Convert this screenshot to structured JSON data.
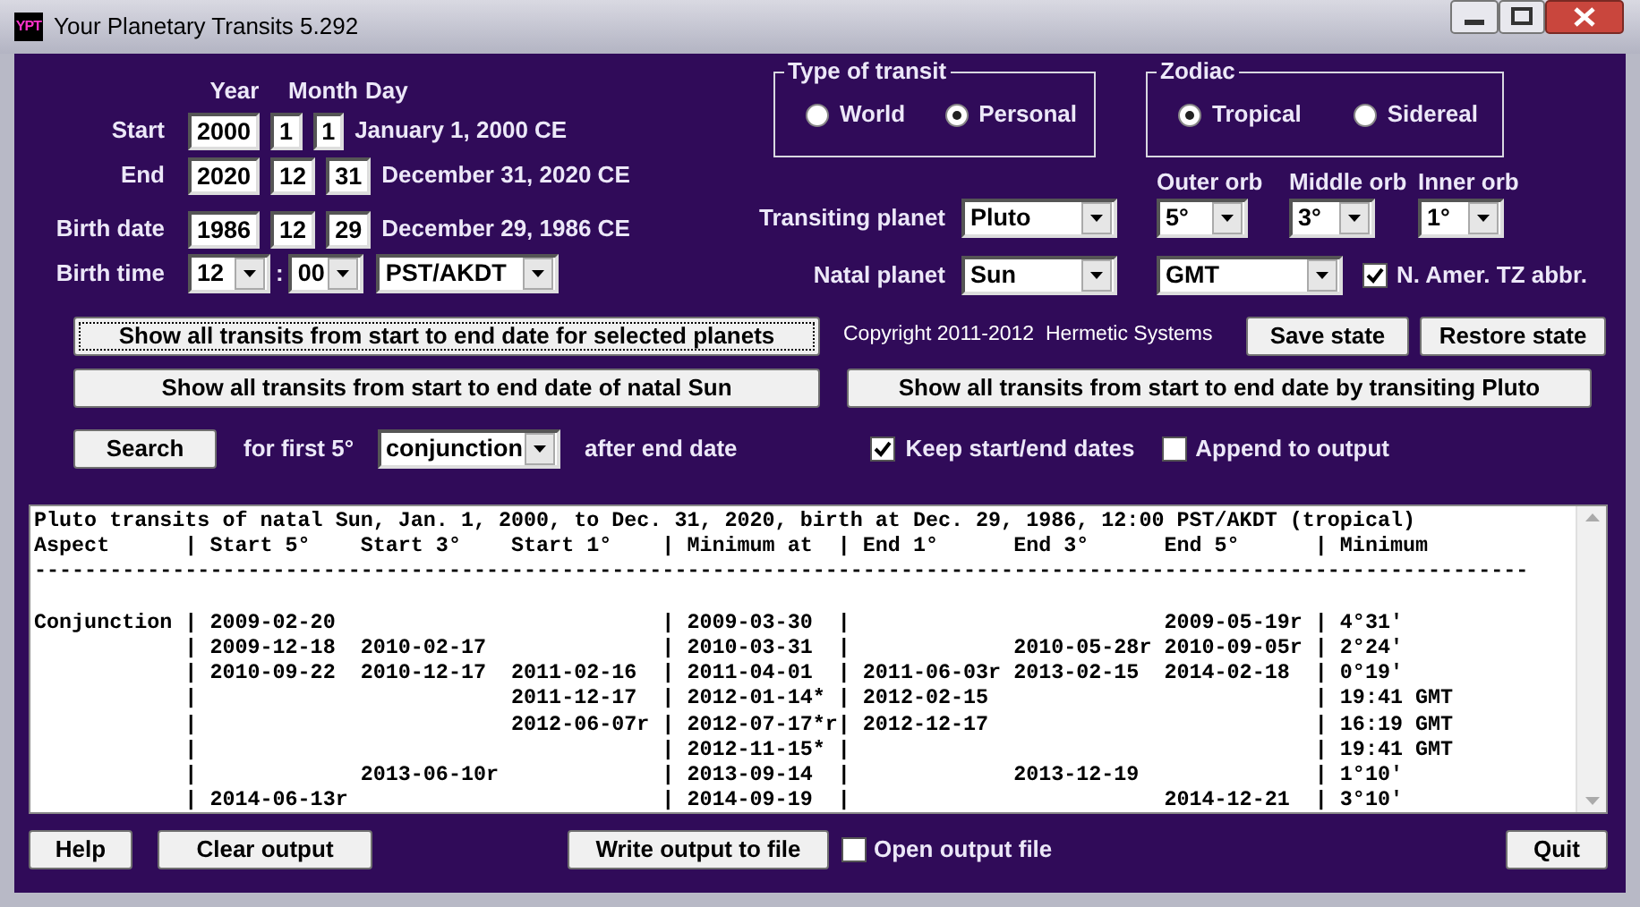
{
  "window": {
    "title": "Your Planetary Transits 5.292",
    "icon_text": "YPT"
  },
  "date_header": {
    "year": "Year",
    "month": "Month",
    "day": "Day"
  },
  "dates": [
    {
      "label": "Start",
      "year": "2000",
      "month": "1",
      "day": "1",
      "text": "January 1, 2000 CE"
    },
    {
      "label": "End",
      "year": "2020",
      "month": "12",
      "day": "31",
      "text": "December 31, 2020 CE"
    },
    {
      "label": "Birth date",
      "year": "1986",
      "month": "12",
      "day": "29",
      "text": "December 29, 1986 CE"
    }
  ],
  "birth_time": {
    "label": "Birth time",
    "hour": "12",
    "separator": ":",
    "minute": "00",
    "zone": "PST/AKDT"
  },
  "type_of_transit": {
    "title": "Type of transit",
    "options": [
      {
        "label": "World",
        "selected": false
      },
      {
        "label": "Personal",
        "selected": true
      }
    ]
  },
  "zodiac": {
    "title": "Zodiac",
    "options": [
      {
        "label": "Tropical",
        "selected": true
      },
      {
        "label": "Sidereal",
        "selected": false
      }
    ]
  },
  "orb_headers": [
    "Outer orb",
    "Middle orb",
    "Inner orb"
  ],
  "transiting_planet": {
    "label": "Transiting planet",
    "value": "Pluto"
  },
  "orbs": [
    "5°",
    "3°",
    "1°"
  ],
  "natal_planet": {
    "label": "Natal planet",
    "value": "Sun"
  },
  "time_zone": "GMT",
  "tz_abbr": {
    "label": "N. Amer. TZ abbr.",
    "checked": true
  },
  "show_selected_button": "Show all transits from start to end date for selected planets",
  "copyright": "Copyright 2011-2012  Hermetic Systems",
  "save_button": "Save state",
  "restore_button": "Restore state",
  "show_natal_button": "Show all transits from start to end date of natal Sun",
  "show_transiting_button": "Show all transits from start to end date by transiting Pluto",
  "search": {
    "button": "Search",
    "prefix": "for first 5°",
    "aspect": "conjunction",
    "suffix": "after end date"
  },
  "keep_dates": {
    "label": "Keep start/end dates",
    "checked": true
  },
  "append_output": {
    "label": "Append to output",
    "checked": false
  },
  "output": {
    "title": "Pluto transits of natal Sun, Jan. 1, 2000, to Dec. 31, 2020, birth at Dec. 29, 1986, 12:00 PST/AKDT (tropical)",
    "header": "Aspect      | Start 5°    Start 3°    Start 1°    | Minimum at  | End 1°      End 3°      End 5°      | Minimum",
    "rule": "-----------------------------------------------------------------------------------------------------------------------",
    "rows": [
      "Conjunction | 2009-02-20                          | 2009-03-30  |                         2009-05-19r | 4°31'",
      "            | 2009-12-18  2010-02-17              | 2010-03-31  |             2010-05-28r 2010-09-05r | 2°24'",
      "            | 2010-09-22  2010-12-17  2011-02-16  | 2011-04-01  | 2011-06-03r 2013-02-15  2014-02-18  | 0°19'",
      "            |                         2011-12-17  | 2012-01-14* | 2012-02-15                          | 19:41 GMT",
      "            |                         2012-06-07r | 2012-07-17*r| 2012-12-17                          | 16:19 GMT",
      "            |                                     | 2012-11-15* |                                     | 19:41 GMT",
      "            |             2013-06-10r             | 2013-09-14  |             2013-12-19              | 1°10'",
      "            | 2014-06-13r                         | 2014-09-19  |                         2014-12-21  | 3°10'"
    ]
  },
  "footer": {
    "help": "Help",
    "clear": "Clear output",
    "write": "Write output to file",
    "open_file": {
      "label": "Open output file",
      "checked": false
    },
    "quit": "Quit"
  }
}
